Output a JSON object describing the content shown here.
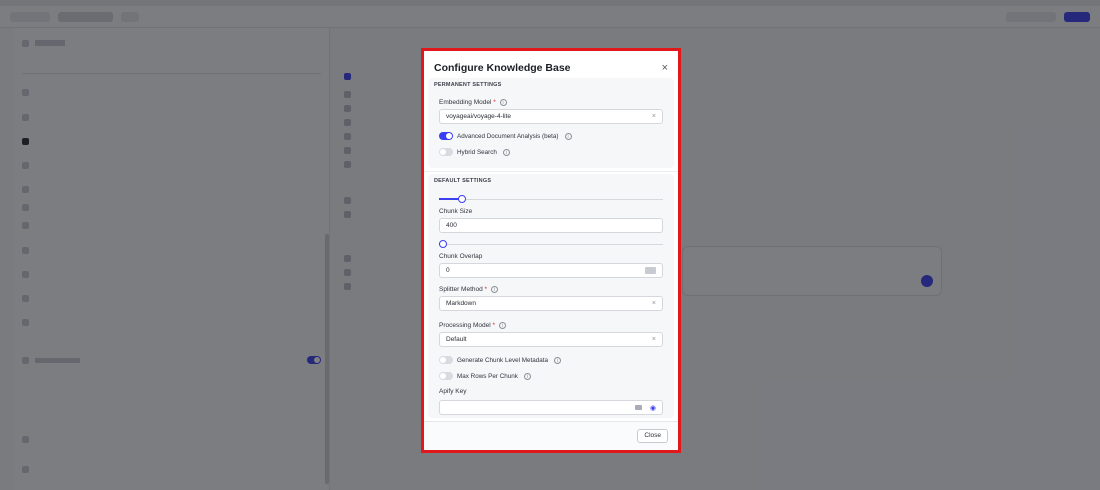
{
  "modal": {
    "title": "Configure Knowledge Base",
    "close_symbol": "×",
    "permanent_settings": {
      "title": "PERMANENT SETTINGS",
      "embedding_model": {
        "label": "Embedding Model",
        "required_mark": "*",
        "value": "voyageai/voyage-4-lite",
        "clear_symbol": "×"
      },
      "advanced_document_analysis": {
        "label": "Advanced Document Analysis (beta)",
        "on": true
      },
      "hybrid_search": {
        "label": "Hybrid Search",
        "on": false
      }
    },
    "default_settings": {
      "title": "DEFAULT SETTINGS",
      "chunk_size": {
        "label": "Chunk Size",
        "value": "400",
        "slider_fraction": 0.09
      },
      "chunk_overlap": {
        "label": "Chunk Overlap",
        "value": "0",
        "slider_fraction": 0.0
      },
      "splitter_method": {
        "label": "Splitter Method",
        "required_mark": "*",
        "value": "Markdown",
        "clear_symbol": "×"
      },
      "processing_model": {
        "label": "Processing Model",
        "required_mark": "*",
        "value": "Default",
        "clear_symbol": "×"
      },
      "generate_chunk_level_metadata": {
        "label": "Generate Chunk Level Metadata",
        "on": false
      },
      "max_rows_per_chunk": {
        "label": "Max Rows Per Chunk",
        "on": false
      },
      "apify_key": {
        "label": "Apify Key",
        "value": ""
      }
    },
    "footer": {
      "close_label": "Close"
    }
  },
  "icons": {
    "info": "i",
    "eye": "◉"
  },
  "colors": {
    "accent": "#3b3ff0",
    "highlight_border": "#e0181b"
  }
}
